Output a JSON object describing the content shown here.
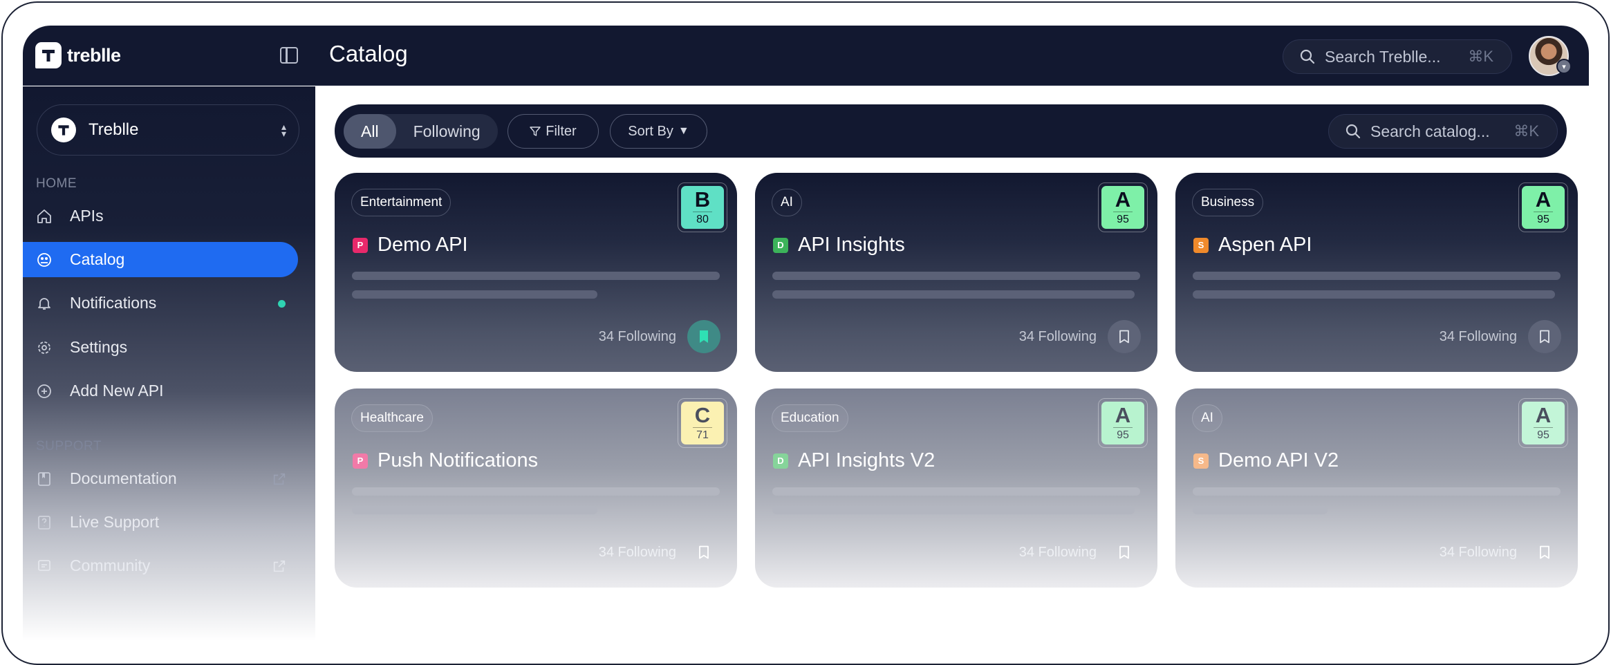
{
  "app": {
    "brand": "treblle",
    "page_title": "Catalog",
    "search_placeholder": "Search Treblle...",
    "search_shortcut": "⌘K"
  },
  "sidebar": {
    "workspace": "Treblle",
    "home_label": "HOME",
    "support_label": "SUPPORT",
    "home_items": [
      {
        "label": "APIs",
        "icon": "home-icon"
      },
      {
        "label": "Catalog",
        "icon": "catalog-icon",
        "active": true
      },
      {
        "label": "Notifications",
        "icon": "bell-icon",
        "has_dot": true
      },
      {
        "label": "Settings",
        "icon": "gear-icon"
      },
      {
        "label": "Add New API",
        "icon": "plus-circle-icon"
      }
    ],
    "support_items": [
      {
        "label": "Documentation",
        "icon": "book-icon",
        "external": true
      },
      {
        "label": "Live Support",
        "icon": "help-icon"
      },
      {
        "label": "Community",
        "icon": "community-icon",
        "external": true
      }
    ]
  },
  "toolbar": {
    "tabs": [
      {
        "label": "All",
        "active": true
      },
      {
        "label": "Following",
        "active": false
      }
    ],
    "filter_label": "Filter",
    "sort_label": "Sort By",
    "search_placeholder": "Search catalog...",
    "search_shortcut": "⌘K"
  },
  "cards": [
    {
      "tag": "Entertainment",
      "badge": "P",
      "badge_color": "#e8296b",
      "title": "Demo API",
      "grade": "B",
      "score": "80",
      "grade_bg": "#5fe0c5",
      "following": "34 Following",
      "bookmarked": true
    },
    {
      "tag": "AI",
      "badge": "D",
      "badge_color": "#3cb35a",
      "title": "API Insights",
      "grade": "A",
      "score": "95",
      "grade_bg": "#7ef0a8",
      "following": "34 Following",
      "bookmarked": false
    },
    {
      "tag": "Business",
      "badge": "S",
      "badge_color": "#f08a2b",
      "title": "Aspen API",
      "grade": "A",
      "score": "95",
      "grade_bg": "#7ef0a8",
      "following": "34 Following",
      "bookmarked": false
    },
    {
      "tag": "Healthcare",
      "badge": "P",
      "badge_color": "#f27aa8",
      "title": "Push Notifications",
      "grade": "C",
      "score": "71",
      "grade_bg": "#fbf1b2",
      "following": "34 Following",
      "bookmarked": false
    },
    {
      "tag": "Education",
      "badge": "D",
      "badge_color": "#86d49a",
      "title": "API Insights V2",
      "grade": "A",
      "score": "95",
      "grade_bg": "#b8f3cf",
      "following": "34 Following",
      "bookmarked": false
    },
    {
      "tag": "AI",
      "badge": "S",
      "badge_color": "#f6b98a",
      "title": "Demo API V2",
      "grade": "A",
      "score": "95",
      "grade_bg": "#c3f5d8",
      "following": "34 Following",
      "bookmarked": false
    }
  ]
}
